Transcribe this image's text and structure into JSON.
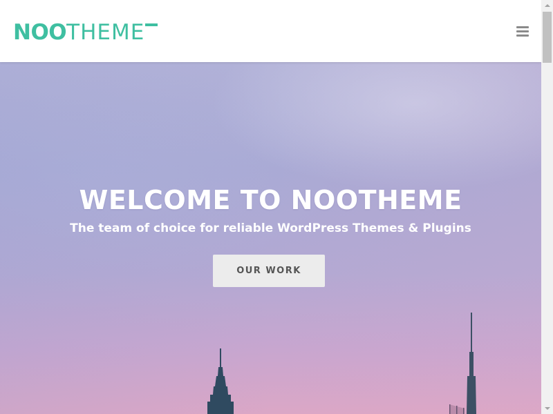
{
  "header": {
    "logo_noo": "NOO",
    "logo_theme": "THEME",
    "menu_icon": "hamburger-menu-icon"
  },
  "hero": {
    "title": "WELCOME TO NOOTHEME",
    "subtitle": "The team of choice for reliable WordPress Themes & Plugins",
    "button_label": "OUR WORK"
  },
  "colors": {
    "brand": "#3fbfa1",
    "button_bg": "#ececec",
    "button_text": "#555555",
    "sky_top": "#b2b2d8",
    "sky_bottom": "#dba7c6",
    "building": "#2f4a60"
  }
}
